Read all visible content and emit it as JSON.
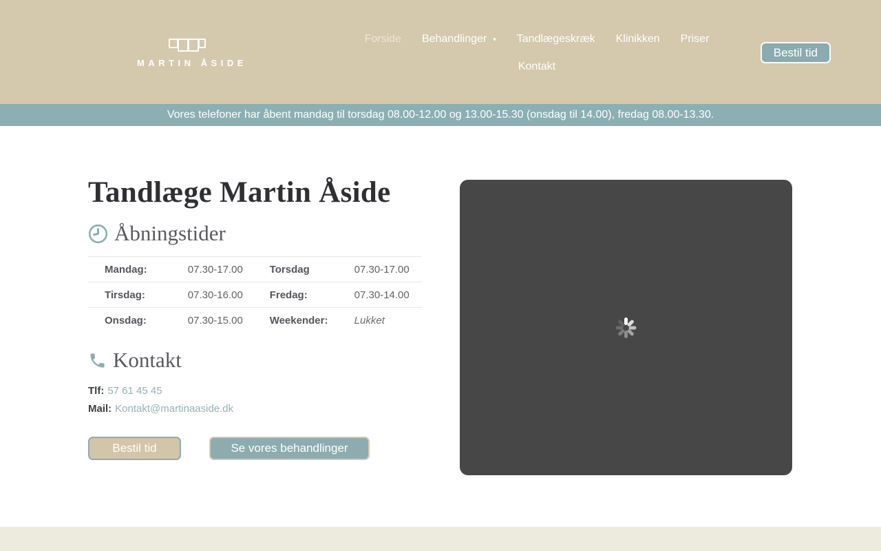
{
  "header": {
    "logo_text": "MARTIN ÅSIDE",
    "nav": [
      {
        "label": "Forside"
      },
      {
        "label": "Behandlinger",
        "dropdown_icon": "▾"
      },
      {
        "label": "Tandlægeskræk"
      },
      {
        "label": "Klinikken"
      },
      {
        "label": "Priser"
      },
      {
        "label": "Kontakt"
      }
    ],
    "book_button": "Bestil tid"
  },
  "announcement": "Vores telefoner har åbent mandag til torsdag 08.00-12.00 og 13.00-15.30 (onsdag til 14.00), fredag 08.00-13.30.",
  "main": {
    "title": "Tandlæge Martin Åside",
    "opening_hours": {
      "heading": "Åbningstider",
      "rows": [
        {
          "day1": "Mandag:",
          "time1": "07.30-17.00",
          "day2": "Torsdag",
          "time2": "07.30-17.00"
        },
        {
          "day1": "Tirsdag:",
          "time1": "07.30-16.00",
          "day2": "Fredag:",
          "time2": "07.30-14.00"
        },
        {
          "day1": "Onsdag:",
          "time1": "07.30-15.00",
          "day2": "Weekender:",
          "time2": "Lukket"
        }
      ]
    },
    "contact": {
      "heading": "Kontakt",
      "phone_label": "Tlf:",
      "phone": "57 61 45 45",
      "mail_label": "Mail:",
      "mail": "Kontakt@martinaaside.dk"
    },
    "buttons": {
      "book": "Bestil tid",
      "treatments": "Se vores behandlinger"
    }
  },
  "icons": {
    "clock": "clock-icon",
    "phone": "phone-icon",
    "teeth_logo": "teeth-logo-icon",
    "spinner": "loading-spinner-icon",
    "chevron": "chevron-down-icon"
  },
  "colors": {
    "header_bg": "#d4c8ad",
    "banner_bg": "#8bafb3",
    "accent_teal": "#8badb1",
    "accent_tan": "#d3c5a9",
    "link_teal": "#94b1b4",
    "media_bg": "#474747",
    "footer_bg": "#edebde",
    "title_text": "#2f3034",
    "section_text": "#595a5f"
  }
}
